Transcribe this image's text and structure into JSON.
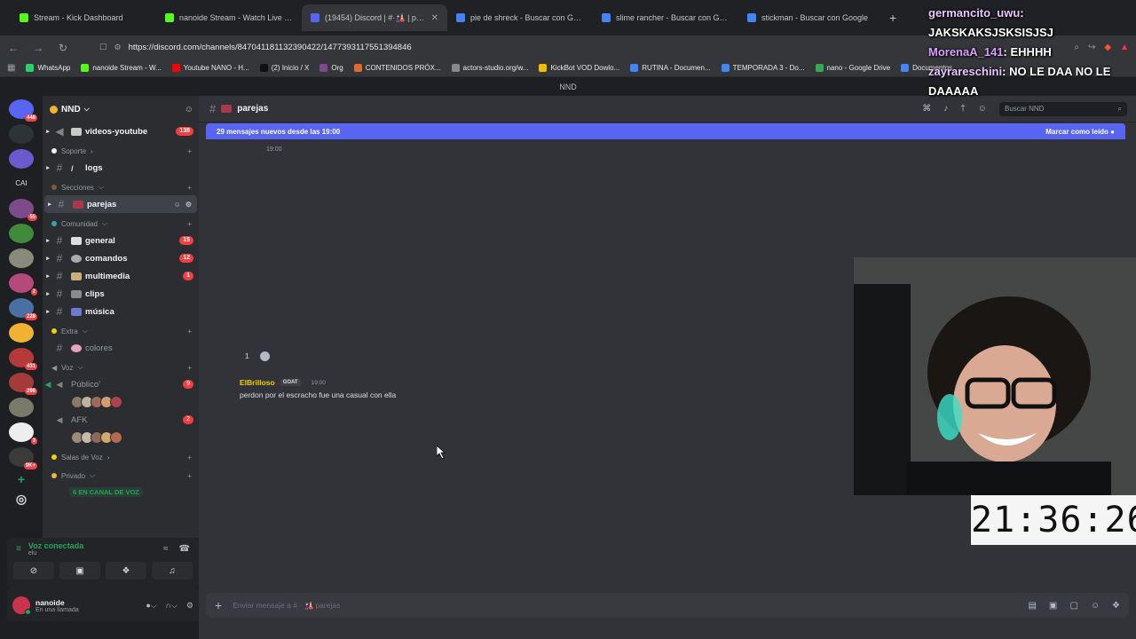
{
  "browser": {
    "tabs": [
      {
        "label": "Stream - Kick Dashboard",
        "color": "#53fc18"
      },
      {
        "label": "nanoide Stream - Watch Live on",
        "color": "#53fc18"
      },
      {
        "label": "(19454) Discord | #·🎎 | pareja",
        "color": "#5865f2",
        "active": true
      },
      {
        "label": "pie de shreck - Buscar con Google",
        "color": "#4285f4"
      },
      {
        "label": "slime rancher - Buscar con Google",
        "color": "#4285f4"
      },
      {
        "label": "stickman - Buscar con Google",
        "color": "#4285f4"
      }
    ],
    "url": "https://discord.com/channels/847041181132390422/1477393117551394846",
    "bookmarks": [
      "WhatsApp",
      "nanoide Stream - W...",
      "Youtube NANO - H...",
      "(2) Inicio / X",
      "Org",
      "CONTENIDOS PRÓX...",
      "actors-studio.org/w...",
      "KickBot VOD Dowlo...",
      "RUTINA - Documen...",
      "TEMPORADA 3 - Do...",
      "nano - Google Drive",
      "Documentos"
    ]
  },
  "window_title": "NND",
  "rail": {
    "servers": [
      {
        "color": "#5865f2",
        "badge": "448"
      },
      {
        "color": "#2e3338",
        "badge": ""
      },
      {
        "color": "#6a5acd",
        "badge": ""
      },
      {
        "color": "#1f2023",
        "badge": "",
        "label": "CAI"
      },
      {
        "color": "#7d4b8a",
        "badge": "55"
      },
      {
        "color": "#3f8b3a",
        "badge": ""
      },
      {
        "color": "#8a8a7a",
        "badge": ""
      },
      {
        "color": "#b44a7a",
        "badge": "2"
      },
      {
        "color": "#4a6fa5",
        "badge": "228"
      },
      {
        "color": "#f0b232",
        "badge": ""
      },
      {
        "color": "#b43a3a",
        "badge": "431"
      },
      {
        "color": "#a33b3b",
        "badge": "298"
      },
      {
        "color": "#7a7a6a",
        "badge": ""
      },
      {
        "color": "#eeeeee",
        "badge": "3"
      },
      {
        "color": "#3b3b3b",
        "badge": "9K+"
      }
    ]
  },
  "sidebar": {
    "server_name": "NND",
    "cat_soporte": "Soporte",
    "cat_secciones": "Secciones",
    "cat_comunidad": "Comunidad",
    "cat_extra": "Extra",
    "cat_voz": "Voz",
    "cat_salas": "Salas de Voz",
    "cat_privado": "Privado",
    "ch_videos": "videos-youtube",
    "ch_videos_count": "138",
    "ch_logs": "logs",
    "ch_parejas": "parejas",
    "ch_general": "general",
    "ch_general_count": "15",
    "ch_comandos": "comandos",
    "ch_comandos_count": "12",
    "ch_multimedia": "multimedia",
    "ch_multimedia_count": "1",
    "ch_clips": "clips",
    "ch_musica": "música",
    "ch_colores": "colores",
    "vc_publico": "Público'",
    "vc_publico_count": "9",
    "vc_afk": "AFK",
    "vc_afk_count": "2",
    "in_voice": "6 EN CANAL DE VOZ"
  },
  "voice_panel": {
    "title": "Voz conectada",
    "sub": "elu"
  },
  "user": {
    "name": "nanoide",
    "status": "En una llamada"
  },
  "channel": {
    "name": "parejas",
    "search_placeholder": "Buscar NND"
  },
  "new_messages": {
    "text": "29 mensajes nuevos desde las 19:00",
    "action": "Marcar como leído"
  },
  "ghost_time": "19:00",
  "reaction_count": "1",
  "message": {
    "author": "ElBrilloso",
    "tag": "GOAT",
    "time": "19:00",
    "text": "perdon por el escracho fue una casual con ella"
  },
  "composer": {
    "placeholder": "Enviar mensaje a #  ·  🎎  parejas"
  },
  "overlay_chat": [
    {
      "user": "germancito_uwu",
      "text": "JAKSKAKSJSKSISJSJ"
    },
    {
      "user": "MorenaA_141",
      "text": "EHHHH"
    },
    {
      "user": "zayrareschini",
      "text": "NO LE DAA NO LE DAAAAA"
    }
  ],
  "clock": "21:36:26"
}
